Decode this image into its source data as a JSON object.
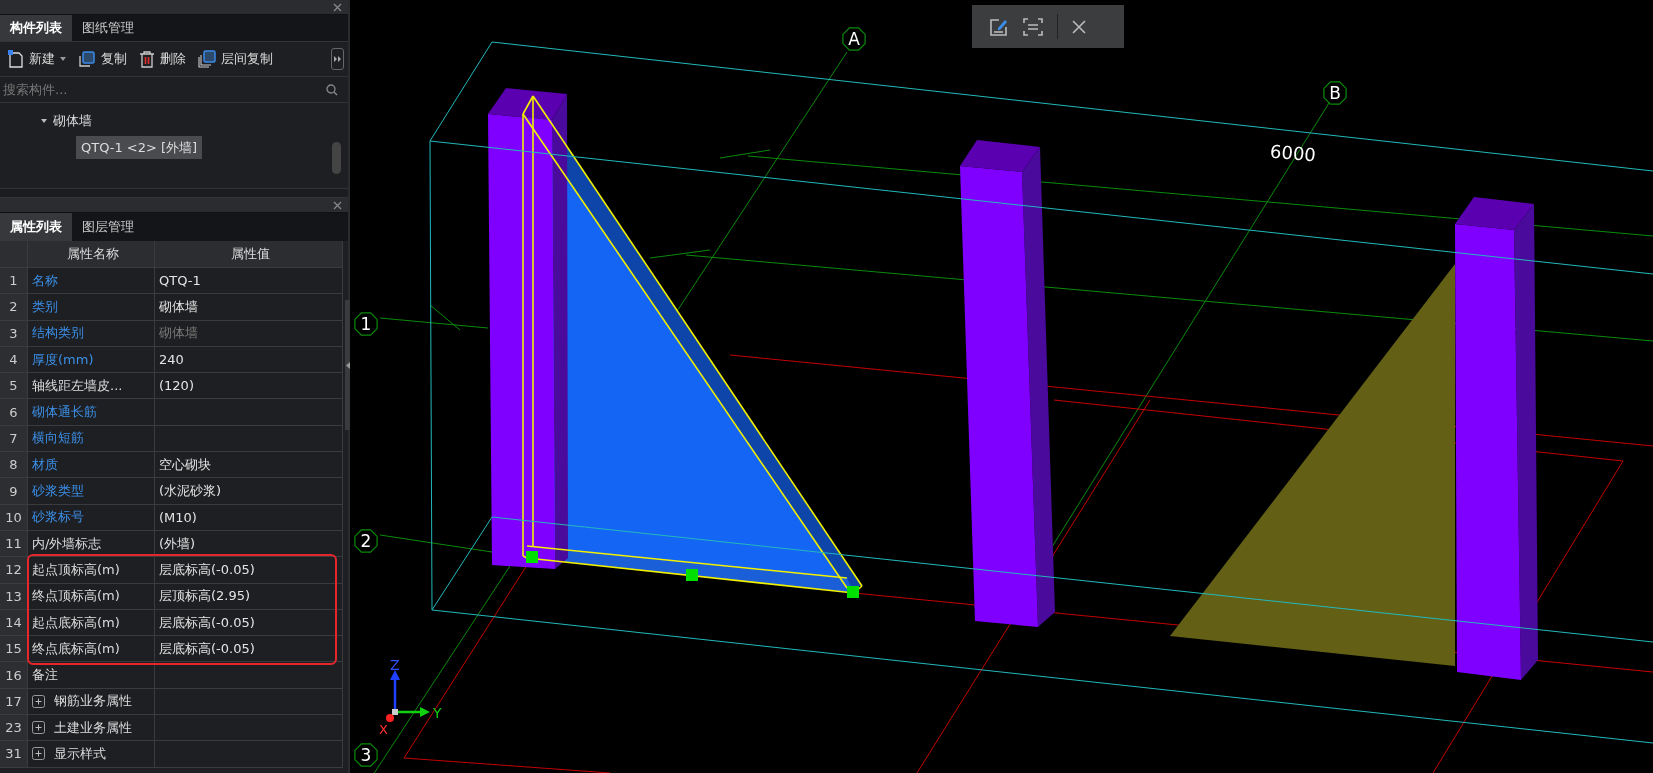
{
  "component_panel": {
    "tabs": [
      {
        "label": "构件列表",
        "selected": true
      },
      {
        "label": "图纸管理",
        "selected": false
      }
    ],
    "toolbar": [
      {
        "kind": "new",
        "label": "新建"
      },
      {
        "kind": "copy",
        "label": "复制"
      },
      {
        "kind": "delete",
        "label": "删除"
      },
      {
        "kind": "floor_copy",
        "label": "层间复制"
      }
    ],
    "search": {
      "placeholder": "搜索构件..."
    },
    "tree": [
      {
        "label": "砌体墙",
        "expanded": true,
        "children": [
          {
            "label": "QTQ-1 <2> [外墙]",
            "selected": true
          }
        ]
      }
    ]
  },
  "property_panel": {
    "tabs": [
      {
        "label": "属性列表",
        "selected": true
      },
      {
        "label": "图层管理",
        "selected": false
      }
    ],
    "columns": [
      "属性名称",
      "属性值"
    ],
    "rows": [
      {
        "kind": "property",
        "no": "1",
        "name": "名称",
        "public": true,
        "value": "QTQ-1",
        "value_disabled": false,
        "highlighted": false
      },
      {
        "kind": "property",
        "no": "2",
        "name": "类别",
        "public": true,
        "value": "砌体墙",
        "value_disabled": false,
        "highlighted": false
      },
      {
        "kind": "property",
        "no": "3",
        "name": "结构类别",
        "public": true,
        "value": "砌体墙",
        "value_disabled": true,
        "highlighted": false
      },
      {
        "kind": "property",
        "no": "4",
        "name": "厚度(mm)",
        "public": true,
        "value": "240",
        "value_disabled": false,
        "highlighted": false
      },
      {
        "kind": "property",
        "no": "5",
        "name": "轴线距左墙皮...",
        "public": false,
        "value": "(120)",
        "value_disabled": false,
        "highlighted": false
      },
      {
        "kind": "property",
        "no": "6",
        "name": "砌体通长筋",
        "public": true,
        "highlighted": false
      },
      {
        "kind": "property",
        "no": "7",
        "name": "横向短筋",
        "public": true,
        "highlighted": false
      },
      {
        "kind": "property",
        "no": "8",
        "name": "材质",
        "public": true,
        "value": "空心砌块",
        "value_disabled": false,
        "highlighted": false
      },
      {
        "kind": "property",
        "no": "9",
        "name": "砂浆类型",
        "public": true,
        "value": "(水泥砂浆)",
        "value_disabled": false,
        "highlighted": false
      },
      {
        "kind": "property",
        "no": "10",
        "name": "砂浆标号",
        "public": true,
        "value": "(M10)",
        "value_disabled": false,
        "highlighted": false
      },
      {
        "kind": "property",
        "no": "11",
        "name": "内/外墙标志",
        "public": false,
        "value": "(外墙)",
        "value_disabled": false,
        "highlighted": false
      },
      {
        "kind": "property",
        "no": "12",
        "name": "起点顶标高(m)",
        "public": false,
        "value": "层底标高(-0.05)",
        "value_disabled": false,
        "highlighted": true
      },
      {
        "kind": "property",
        "no": "13",
        "name": "终点顶标高(m)",
        "public": false,
        "value": "层顶标高(2.95)",
        "value_disabled": false,
        "highlighted": true
      },
      {
        "kind": "property",
        "no": "14",
        "name": "起点底标高(m)",
        "public": false,
        "value": "层底标高(-0.05)",
        "value_disabled": false,
        "highlighted": true
      },
      {
        "kind": "property",
        "no": "15",
        "name": "终点底标高(m)",
        "public": false,
        "value": "层底标高(-0.05)",
        "value_disabled": false,
        "highlighted": true
      },
      {
        "kind": "property",
        "no": "16",
        "name": "备注",
        "public": false,
        "highlighted": false
      },
      {
        "kind": "group",
        "no": "17",
        "name": "钢筋业务属性",
        "expanded": false,
        "highlighted": false
      },
      {
        "kind": "group",
        "no": "23",
        "name": "土建业务属性",
        "expanded": false,
        "highlighted": false
      },
      {
        "kind": "group",
        "no": "31",
        "name": "显示样式",
        "expanded": false,
        "highlighted": false
      }
    ]
  },
  "viewport": {
    "axes": [
      {
        "kind": "column_axis",
        "label": "A"
      },
      {
        "kind": "column_axis",
        "label": "B"
      },
      {
        "kind": "row_axis",
        "label": "1"
      },
      {
        "kind": "row_axis",
        "label": "2"
      },
      {
        "kind": "row_axis",
        "label": "3"
      }
    ],
    "dimension": "6000",
    "gizmo": {
      "z": "Z",
      "y": "Y",
      "x": "X"
    }
  }
}
